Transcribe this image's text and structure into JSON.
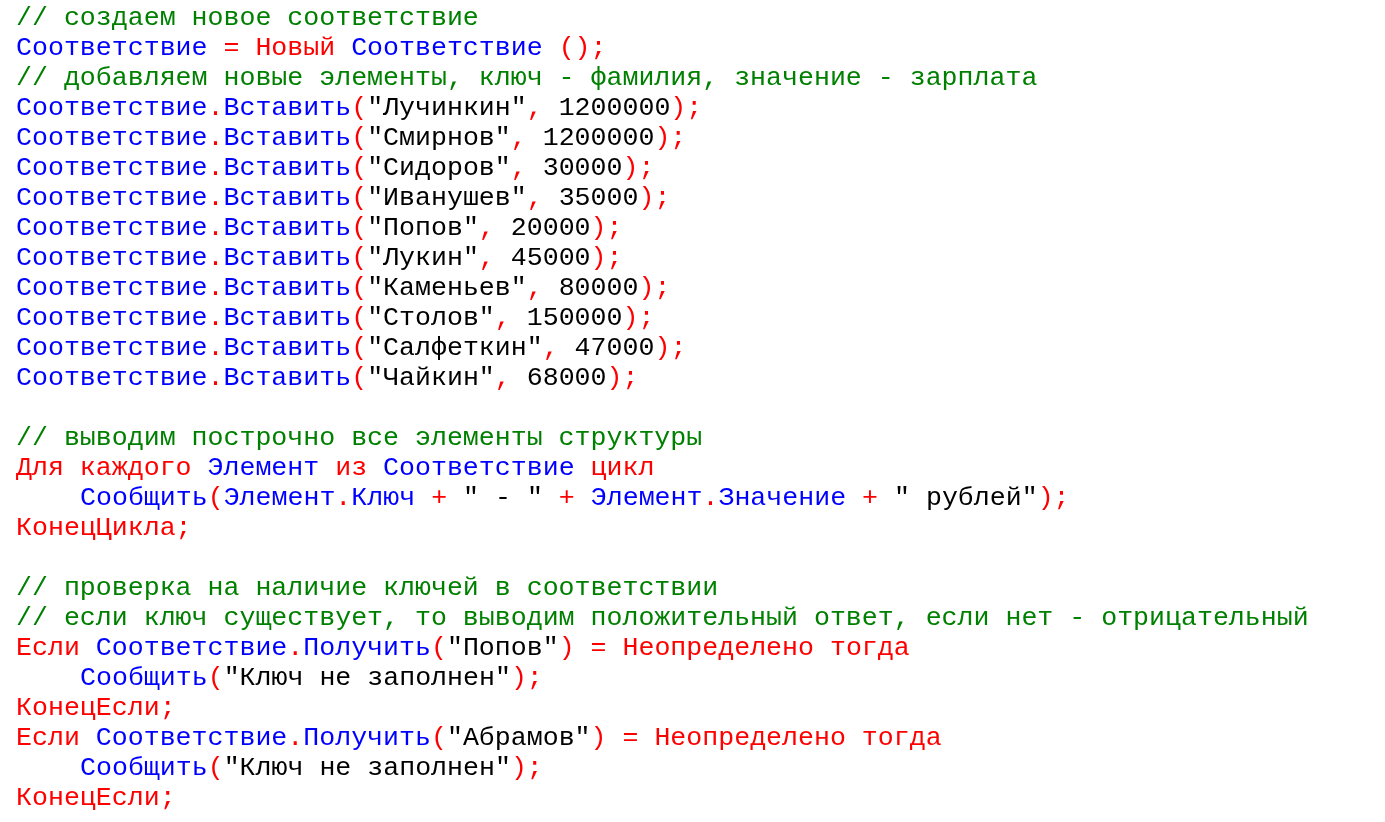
{
  "code_lines": [
    {
      "kind": "code",
      "indented": false,
      "tokens": [
        {
          "kind": "comment",
          "text": "// создаем новое соответствие"
        }
      ]
    },
    {
      "kind": "code",
      "indented": false,
      "tokens": [
        {
          "kind": "ident",
          "text": "Соответствие"
        },
        {
          "kind": "op",
          "text": " = Новый "
        },
        {
          "kind": "ident",
          "text": "Соответствие"
        },
        {
          "kind": "op",
          "text": " ();"
        }
      ]
    },
    {
      "kind": "code",
      "indented": false,
      "tokens": [
        {
          "kind": "comment",
          "text": "// добавляем новые элементы, ключ - фамилия, значение - зарплата"
        }
      ]
    },
    {
      "kind": "code",
      "indented": false,
      "tokens": [
        {
          "kind": "ident",
          "text": "Соответствие"
        },
        {
          "kind": "op",
          "text": "."
        },
        {
          "kind": "ident",
          "text": "Вставить"
        },
        {
          "kind": "op",
          "text": "("
        },
        {
          "kind": "literal",
          "text": "\"Лучинкин\""
        },
        {
          "kind": "op",
          "text": ","
        },
        {
          "kind": "literal",
          "text": " 1200000"
        },
        {
          "kind": "op",
          "text": ");"
        }
      ]
    },
    {
      "kind": "code",
      "indented": false,
      "tokens": [
        {
          "kind": "ident",
          "text": "Соответствие"
        },
        {
          "kind": "op",
          "text": "."
        },
        {
          "kind": "ident",
          "text": "Вставить"
        },
        {
          "kind": "op",
          "text": "("
        },
        {
          "kind": "literal",
          "text": "\"Смирнов\""
        },
        {
          "kind": "op",
          "text": ","
        },
        {
          "kind": "literal",
          "text": " 1200000"
        },
        {
          "kind": "op",
          "text": ");"
        }
      ]
    },
    {
      "kind": "code",
      "indented": false,
      "tokens": [
        {
          "kind": "ident",
          "text": "Соответствие"
        },
        {
          "kind": "op",
          "text": "."
        },
        {
          "kind": "ident",
          "text": "Вставить"
        },
        {
          "kind": "op",
          "text": "("
        },
        {
          "kind": "literal",
          "text": "\"Сидоров\""
        },
        {
          "kind": "op",
          "text": ","
        },
        {
          "kind": "literal",
          "text": " 30000"
        },
        {
          "kind": "op",
          "text": ");"
        }
      ]
    },
    {
      "kind": "code",
      "indented": false,
      "tokens": [
        {
          "kind": "ident",
          "text": "Соответствие"
        },
        {
          "kind": "op",
          "text": "."
        },
        {
          "kind": "ident",
          "text": "Вставить"
        },
        {
          "kind": "op",
          "text": "("
        },
        {
          "kind": "literal",
          "text": "\"Иванушев\""
        },
        {
          "kind": "op",
          "text": ","
        },
        {
          "kind": "literal",
          "text": " 35000"
        },
        {
          "kind": "op",
          "text": ");"
        }
      ]
    },
    {
      "kind": "code",
      "indented": false,
      "tokens": [
        {
          "kind": "ident",
          "text": "Соответствие"
        },
        {
          "kind": "op",
          "text": "."
        },
        {
          "kind": "ident",
          "text": "Вставить"
        },
        {
          "kind": "op",
          "text": "("
        },
        {
          "kind": "literal",
          "text": "\"Попов\""
        },
        {
          "kind": "op",
          "text": ","
        },
        {
          "kind": "literal",
          "text": " 20000"
        },
        {
          "kind": "op",
          "text": ");"
        }
      ]
    },
    {
      "kind": "code",
      "indented": false,
      "tokens": [
        {
          "kind": "ident",
          "text": "Соответствие"
        },
        {
          "kind": "op",
          "text": "."
        },
        {
          "kind": "ident",
          "text": "Вставить"
        },
        {
          "kind": "op",
          "text": "("
        },
        {
          "kind": "literal",
          "text": "\"Лукин\""
        },
        {
          "kind": "op",
          "text": ","
        },
        {
          "kind": "literal",
          "text": " 45000"
        },
        {
          "kind": "op",
          "text": ");"
        }
      ]
    },
    {
      "kind": "code",
      "indented": false,
      "tokens": [
        {
          "kind": "ident",
          "text": "Соответствие"
        },
        {
          "kind": "op",
          "text": "."
        },
        {
          "kind": "ident",
          "text": "Вставить"
        },
        {
          "kind": "op",
          "text": "("
        },
        {
          "kind": "literal",
          "text": "\"Каменьев\""
        },
        {
          "kind": "op",
          "text": ","
        },
        {
          "kind": "literal",
          "text": " 80000"
        },
        {
          "kind": "op",
          "text": ");"
        }
      ]
    },
    {
      "kind": "code",
      "indented": false,
      "tokens": [
        {
          "kind": "ident",
          "text": "Соответствие"
        },
        {
          "kind": "op",
          "text": "."
        },
        {
          "kind": "ident",
          "text": "Вставить"
        },
        {
          "kind": "op",
          "text": "("
        },
        {
          "kind": "literal",
          "text": "\"Столов\""
        },
        {
          "kind": "op",
          "text": ","
        },
        {
          "kind": "literal",
          "text": " 150000"
        },
        {
          "kind": "op",
          "text": ");"
        }
      ]
    },
    {
      "kind": "code",
      "indented": false,
      "tokens": [
        {
          "kind": "ident",
          "text": "Соответствие"
        },
        {
          "kind": "op",
          "text": "."
        },
        {
          "kind": "ident",
          "text": "Вставить"
        },
        {
          "kind": "op",
          "text": "("
        },
        {
          "kind": "literal",
          "text": "\"Салфеткин\""
        },
        {
          "kind": "op",
          "text": ","
        },
        {
          "kind": "literal",
          "text": " 47000"
        },
        {
          "kind": "op",
          "text": ");"
        }
      ]
    },
    {
      "kind": "code",
      "indented": false,
      "tokens": [
        {
          "kind": "ident",
          "text": "Соответствие"
        },
        {
          "kind": "op",
          "text": "."
        },
        {
          "kind": "ident",
          "text": "Вставить"
        },
        {
          "kind": "op",
          "text": "("
        },
        {
          "kind": "literal",
          "text": "\"Чайкин\""
        },
        {
          "kind": "op",
          "text": ","
        },
        {
          "kind": "literal",
          "text": " 68000"
        },
        {
          "kind": "op",
          "text": ");"
        }
      ]
    },
    {
      "kind": "blank"
    },
    {
      "kind": "code",
      "indented": false,
      "tokens": [
        {
          "kind": "comment",
          "text": "// выводим построчно все элементы структуры"
        }
      ]
    },
    {
      "kind": "code",
      "indented": false,
      "tokens": [
        {
          "kind": "op",
          "text": "Для каждого "
        },
        {
          "kind": "ident",
          "text": "Элемент"
        },
        {
          "kind": "op",
          "text": " из "
        },
        {
          "kind": "ident",
          "text": "Соответствие"
        },
        {
          "kind": "op",
          "text": " цикл"
        }
      ]
    },
    {
      "kind": "code",
      "indented": true,
      "tokens": [
        {
          "kind": "ident",
          "text": "Сообщить"
        },
        {
          "kind": "op",
          "text": "("
        },
        {
          "kind": "ident",
          "text": "Элемент"
        },
        {
          "kind": "op",
          "text": "."
        },
        {
          "kind": "ident",
          "text": "Ключ"
        },
        {
          "kind": "op",
          "text": " + "
        },
        {
          "kind": "literal",
          "text": "\" - \""
        },
        {
          "kind": "op",
          "text": " + "
        },
        {
          "kind": "ident",
          "text": "Элемент"
        },
        {
          "kind": "op",
          "text": "."
        },
        {
          "kind": "ident",
          "text": "Значение"
        },
        {
          "kind": "op",
          "text": " + "
        },
        {
          "kind": "literal",
          "text": "\" рублей\""
        },
        {
          "kind": "op",
          "text": ");"
        }
      ]
    },
    {
      "kind": "code",
      "indented": false,
      "tokens": [
        {
          "kind": "op",
          "text": "КонецЦикла;"
        }
      ]
    },
    {
      "kind": "blank"
    },
    {
      "kind": "code",
      "indented": false,
      "tokens": [
        {
          "kind": "comment",
          "text": "// проверка на наличие ключей в соответствии"
        }
      ]
    },
    {
      "kind": "code",
      "indented": false,
      "tokens": [
        {
          "kind": "comment",
          "text": "// если ключ существует, то выводим положительный ответ, если нет - отрицательный"
        }
      ]
    },
    {
      "kind": "code",
      "indented": false,
      "tokens": [
        {
          "kind": "op",
          "text": "Если "
        },
        {
          "kind": "ident",
          "text": "Соответствие"
        },
        {
          "kind": "op",
          "text": "."
        },
        {
          "kind": "ident",
          "text": "Получить"
        },
        {
          "kind": "op",
          "text": "("
        },
        {
          "kind": "literal",
          "text": "\"Попов\""
        },
        {
          "kind": "op",
          "text": ") = Неопределено тогда"
        }
      ]
    },
    {
      "kind": "code",
      "indented": true,
      "tokens": [
        {
          "kind": "ident",
          "text": "Сообщить"
        },
        {
          "kind": "op",
          "text": "("
        },
        {
          "kind": "literal",
          "text": "\"Ключ не заполнен\""
        },
        {
          "kind": "op",
          "text": ");"
        }
      ]
    },
    {
      "kind": "code",
      "indented": false,
      "tokens": [
        {
          "kind": "op",
          "text": "КонецЕсли;"
        }
      ]
    },
    {
      "kind": "code",
      "indented": false,
      "tokens": [
        {
          "kind": "op",
          "text": "Если "
        },
        {
          "kind": "ident",
          "text": "Соответствие"
        },
        {
          "kind": "op",
          "text": "."
        },
        {
          "kind": "ident",
          "text": "Получить"
        },
        {
          "kind": "op",
          "text": "("
        },
        {
          "kind": "literal",
          "text": "\"Абрамов\""
        },
        {
          "kind": "op",
          "text": ") = Неопределено тогда"
        }
      ]
    },
    {
      "kind": "code",
      "indented": true,
      "tokens": [
        {
          "kind": "ident",
          "text": "Сообщить"
        },
        {
          "kind": "op",
          "text": "("
        },
        {
          "kind": "literal",
          "text": "\"Ключ не заполнен\""
        },
        {
          "kind": "op",
          "text": ");"
        }
      ]
    },
    {
      "kind": "code",
      "indented": false,
      "tokens": [
        {
          "kind": "op",
          "text": "КонецЕсли;"
        }
      ]
    }
  ]
}
